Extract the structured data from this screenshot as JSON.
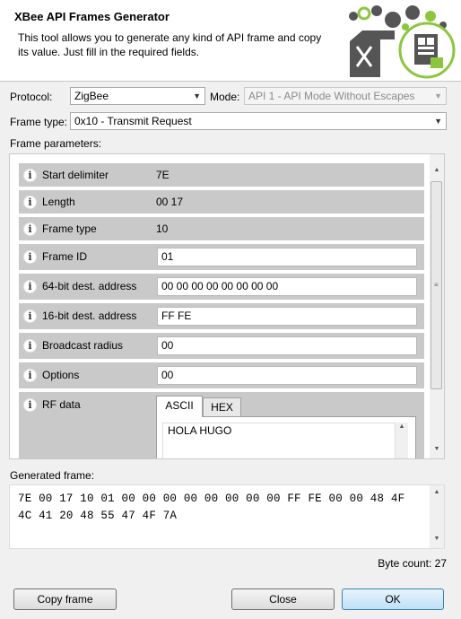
{
  "header": {
    "title": "XBee API Frames Generator",
    "description": "This tool allows you to generate any kind of API frame and copy its value. Just fill in the required fields."
  },
  "protocol": {
    "label": "Protocol:",
    "value": "ZigBee"
  },
  "mode": {
    "label": "Mode:",
    "value": "API 1 - API Mode Without Escapes"
  },
  "frame_type": {
    "label": "Frame type:",
    "value": "0x10 - Transmit Request"
  },
  "frame_parameters": {
    "label": "Frame parameters:",
    "rows": [
      {
        "label": "Start delimiter",
        "value": "7E"
      },
      {
        "label": "Length",
        "value": "00 17"
      },
      {
        "label": "Frame type",
        "value": "10"
      },
      {
        "label": "Frame ID",
        "value": "01"
      },
      {
        "label": "64-bit dest. address",
        "value": "00 00 00 00 00 00 00 00"
      },
      {
        "label": "16-bit dest. address",
        "value": "FF FE"
      },
      {
        "label": "Broadcast radius",
        "value": "00"
      },
      {
        "label": "Options",
        "value": "00"
      },
      {
        "label": "RF data",
        "value": ""
      }
    ],
    "info_icon": "i",
    "rf_tabs": [
      "ASCII",
      "HEX"
    ],
    "rf_text": "HOLA HUGO"
  },
  "generated": {
    "label": "Generated frame:",
    "line1": "7E 00 17 10 01 00 00 00 00 00 00 00 00 FF FE 00 00 48 4F",
    "line2": "4C 41 20 48 55 47 4F 7A",
    "byte_count": "Byte count: 27"
  },
  "buttons": {
    "copy": "Copy frame",
    "close": "Close",
    "ok": "OK"
  },
  "colors": {
    "logo_green": "#8cc63f",
    "logo_dark": "#555555",
    "row_bg": "#c9c9c9",
    "ok_border": "#3c7fb1"
  }
}
